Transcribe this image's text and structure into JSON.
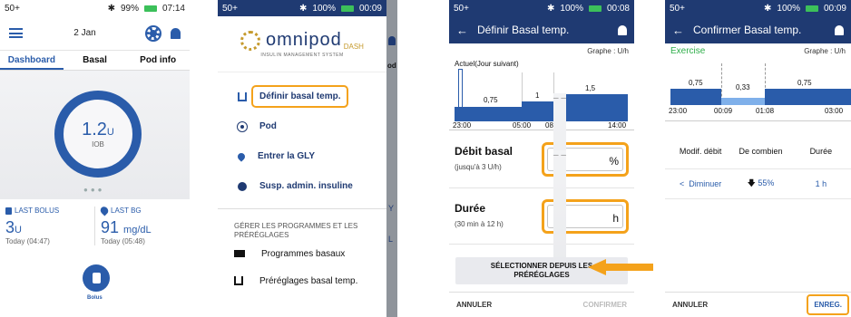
{
  "colors": {
    "primary": "#2a5caa",
    "navy": "#1f3a72",
    "highlight": "#f4a21b",
    "battery": "#3cc05a",
    "exercise": "#2fae4a"
  },
  "s1": {
    "status": {
      "signal": "50+",
      "battery": "99%",
      "time": "07:14"
    },
    "header": {
      "date": "2 Jan",
      "menu_icon": "hamburger-icon",
      "gear_icon": "gear-icon",
      "bell_icon": "bell-icon"
    },
    "tabs": [
      "Dashboard",
      "Basal",
      "Pod info"
    ],
    "iob": {
      "value": "1.2",
      "unit": "U",
      "label": "IOB"
    },
    "last_bolus": {
      "label": "LAST BOLUS",
      "value": "3",
      "unit": "U",
      "sub": "Today (04:47)"
    },
    "last_bg": {
      "label": "LAST BG",
      "value": "91",
      "unit": "mg/dL",
      "sub": "Today (05:48)"
    },
    "bolus_label": "Bolus"
  },
  "s2": {
    "status": {
      "signal": "50+",
      "battery": "100%",
      "time": "00:09"
    },
    "logo": {
      "name": "omnipod",
      "dash": "DASH",
      "tagline": "INSULIN MANAGEMENT SYSTEM"
    },
    "menu": [
      "Définir basal temp.",
      "Pod",
      "Entrer la GLY",
      "Susp. admin. insuline"
    ],
    "group_label": "GÉRER LES PROGRAMMES ET LES PRÉRÉGLAGES",
    "group_items": [
      "Programmes basaux",
      "Préréglages basal temp."
    ],
    "behind": {
      "tab": "od",
      "letter1": "Y",
      "letter2": "L"
    }
  },
  "s3": {
    "status": {
      "signal": "50+",
      "battery": "100%",
      "time": "00:08"
    },
    "title": "Définir Basal temp.",
    "graph_unit": "Graphe : U/h",
    "graph_current": "Actuel(Jour suivant)",
    "segments": [
      {
        "from": "23:00",
        "to": "05:00",
        "rate": "0,75"
      },
      {
        "from": "05:00",
        "to": "08:00",
        "rate": "1"
      },
      {
        "from": "08:00",
        "to": "14:00",
        "rate": "1,5"
      }
    ],
    "ticks": [
      "23:00",
      "05:00",
      "08:00",
      "14:00"
    ],
    "debit": {
      "label": "Débit basal",
      "hint": "(jusqu'à 3 U/h)",
      "placeholder": "– –",
      "unit": "%"
    },
    "duree": {
      "label": "Durée",
      "hint": "(30 min à 12 h)",
      "placeholder": "– –",
      "unit": "h"
    },
    "select_presets": "SÉLECTIONNER DEPUIS LES PRÉRÉGLAGES",
    "cancel": "ANNULER",
    "confirm": "CONFIRMER"
  },
  "s4": {
    "status": {
      "signal": "50+",
      "battery": "100%",
      "time": "00:09"
    },
    "title": "Confirmer Basal temp.",
    "preset_name": "Exercise",
    "graph_unit": "Graphe : U/h",
    "rates": [
      "0,75",
      "0,33",
      "0,75"
    ],
    "ticks": [
      "23:00",
      "00:09",
      "01:08",
      "03:00"
    ],
    "table_headers": [
      "Modif. débit",
      "De combien",
      "Durée"
    ],
    "row": {
      "direction": "Diminuer",
      "amount": "55%",
      "duration": "1 h"
    },
    "cancel": "ANNULER",
    "save": "ENREG."
  }
}
